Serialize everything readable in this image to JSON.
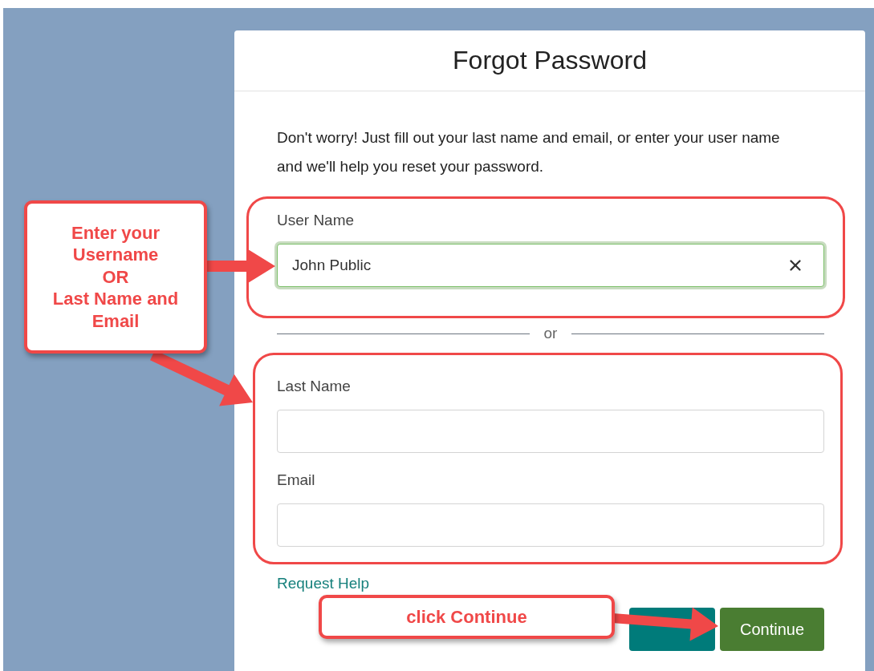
{
  "dialog": {
    "title": "Forgot Password",
    "intro": "Don't worry! Just fill out your last name and email, or enter your user name and we'll help you reset your password.",
    "user_name": {
      "label": "User Name",
      "value": "John Public",
      "focused": true
    },
    "divider": "or",
    "last_name": {
      "label": "Last Name"
    },
    "email": {
      "label": "Email"
    },
    "help_link": "Request Help",
    "buttons": [
      {
        "kind": "secondary"
      },
      {
        "kind": "primary",
        "label": "Continue"
      }
    ]
  },
  "annotations": [
    {
      "kind": "callout",
      "text": "Enter your\nUsername\nOR\nLast Name and\nEmail"
    },
    {
      "kind": "callout",
      "text": "click Continue"
    }
  ]
}
